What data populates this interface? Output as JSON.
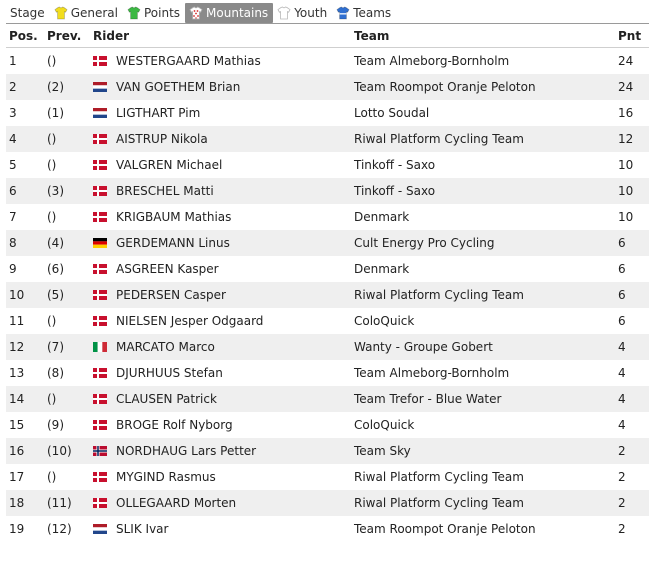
{
  "tabs": [
    {
      "label": "Stage",
      "icon": "",
      "active": false
    },
    {
      "label": "General",
      "icon": "yellow-jersey-icon",
      "color": "#f2dd1e",
      "active": false
    },
    {
      "label": "Points",
      "icon": "green-jersey-icon",
      "color": "#3cb843",
      "active": false
    },
    {
      "label": "Mountains",
      "icon": "polka-dot-jersey-icon",
      "color": "#d42a2a",
      "active": true
    },
    {
      "label": "Youth",
      "icon": "white-jersey-icon",
      "color": "#ffffff",
      "active": false
    },
    {
      "label": "Teams",
      "icon": "blue-jersey-icon",
      "color": "#2f6fd1",
      "active": false
    }
  ],
  "table": {
    "headers": {
      "pos": "Pos.",
      "prev": "Prev.",
      "rider": "Rider",
      "team": "Team",
      "pnt": "Pnt"
    },
    "rows": [
      {
        "pos": "1",
        "prev": "()",
        "flag": "dk",
        "rider": "WESTERGAARD Mathias",
        "team": "Team Almeborg-Bornholm",
        "pnt": "24"
      },
      {
        "pos": "2",
        "prev": "(2)",
        "flag": "nl",
        "rider": "VAN GOETHEM Brian",
        "team": "Team Roompot Oranje Peloton",
        "pnt": "24"
      },
      {
        "pos": "3",
        "prev": "(1)",
        "flag": "nl",
        "rider": "LIGTHART Pim",
        "team": "Lotto Soudal",
        "pnt": "16"
      },
      {
        "pos": "4",
        "prev": "()",
        "flag": "dk",
        "rider": "AISTRUP Nikola",
        "team": "Riwal Platform Cycling Team",
        "pnt": "12"
      },
      {
        "pos": "5",
        "prev": "()",
        "flag": "dk",
        "rider": "VALGREN Michael",
        "team": "Tinkoff - Saxo",
        "pnt": "10"
      },
      {
        "pos": "6",
        "prev": "(3)",
        "flag": "dk",
        "rider": "BRESCHEL Matti",
        "team": "Tinkoff - Saxo",
        "pnt": "10"
      },
      {
        "pos": "7",
        "prev": "()",
        "flag": "dk",
        "rider": "KRIGBAUM Mathias",
        "team": "Denmark",
        "pnt": "10"
      },
      {
        "pos": "8",
        "prev": "(4)",
        "flag": "de",
        "rider": "GERDEMANN Linus",
        "team": "Cult Energy Pro Cycling",
        "pnt": "6"
      },
      {
        "pos": "9",
        "prev": "(6)",
        "flag": "dk",
        "rider": "ASGREEN Kasper",
        "team": "Denmark",
        "pnt": "6"
      },
      {
        "pos": "10",
        "prev": "(5)",
        "flag": "dk",
        "rider": "PEDERSEN Casper",
        "team": "Riwal Platform Cycling Team",
        "pnt": "6"
      },
      {
        "pos": "11",
        "prev": "()",
        "flag": "dk",
        "rider": "NIELSEN Jesper Odgaard",
        "team": "ColoQuick",
        "pnt": "6"
      },
      {
        "pos": "12",
        "prev": "(7)",
        "flag": "it",
        "rider": "MARCATO Marco",
        "team": "Wanty - Groupe Gobert",
        "pnt": "4"
      },
      {
        "pos": "13",
        "prev": "(8)",
        "flag": "dk",
        "rider": "DJURHUUS Stefan",
        "team": "Team Almeborg-Bornholm",
        "pnt": "4"
      },
      {
        "pos": "14",
        "prev": "()",
        "flag": "dk",
        "rider": "CLAUSEN Patrick",
        "team": "Team Trefor - Blue Water",
        "pnt": "4"
      },
      {
        "pos": "15",
        "prev": "(9)",
        "flag": "dk",
        "rider": "BROGE Rolf Nyborg",
        "team": "ColoQuick",
        "pnt": "4"
      },
      {
        "pos": "16",
        "prev": "(10)",
        "flag": "no",
        "rider": "NORDHAUG Lars Petter",
        "team": "Team Sky",
        "pnt": "2"
      },
      {
        "pos": "17",
        "prev": "()",
        "flag": "dk",
        "rider": "MYGIND Rasmus",
        "team": "Riwal Platform Cycling Team",
        "pnt": "2"
      },
      {
        "pos": "18",
        "prev": "(11)",
        "flag": "dk",
        "rider": "OLLEGAARD Morten",
        "team": "Riwal Platform Cycling Team",
        "pnt": "2"
      },
      {
        "pos": "19",
        "prev": "(12)",
        "flag": "nl",
        "rider": "SLIK Ivar",
        "team": "Team Roompot Oranje Peloton",
        "pnt": "2"
      }
    ]
  }
}
